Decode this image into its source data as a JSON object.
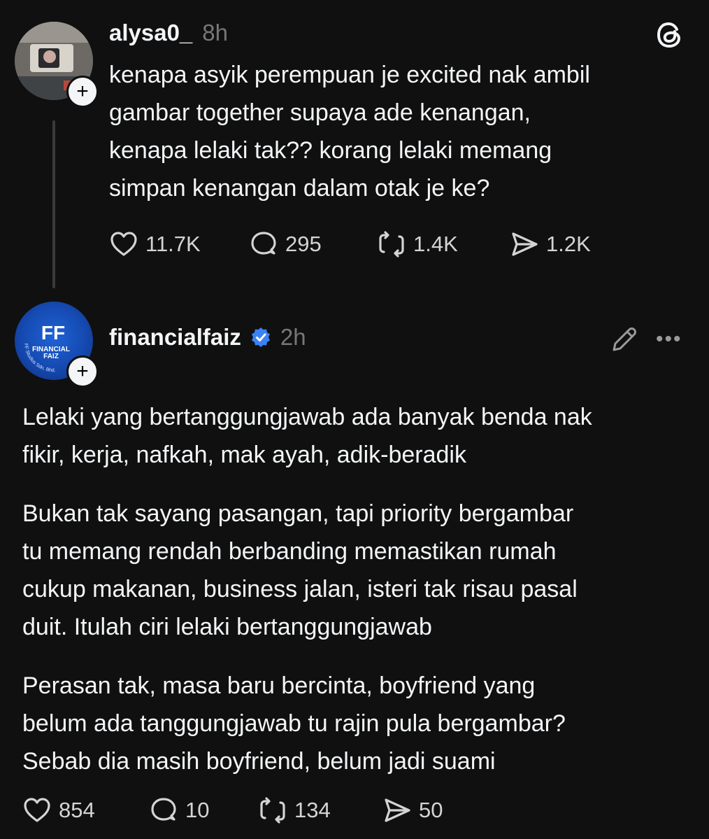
{
  "post1": {
    "username": "alysa0_",
    "timestamp": "8h",
    "text_lines": [
      "kenapa asyik perempuan je excited nak ambil",
      "gambar together supaya ade kenangan,",
      "kenapa lelaki tak?? korang lelaki memang",
      "simpan kenangan dalam otak je ke?"
    ],
    "actions": {
      "likes": "11.7K",
      "replies": "295",
      "reposts": "1.4K",
      "shares": "1.2K"
    }
  },
  "post2": {
    "username": "financialfaiz",
    "timestamp": "2h",
    "avatar_text": {
      "logo": "FF",
      "line1": "FINANCIAL",
      "line2": "FAIZ",
      "arc": "FF Studios Sdn. Bhd."
    },
    "paragraphs": [
      [
        "Lelaki yang bertanggungjawab ada banyak benda nak",
        "fikir, kerja, nafkah, mak ayah, adik-beradik"
      ],
      [
        "Bukan tak sayang pasangan, tapi priority bergambar",
        "tu memang rendah berbanding memastikan rumah",
        "cukup makanan, business jalan, isteri tak risau pasal",
        "duit. Itulah ciri lelaki bertanggungjawab"
      ],
      [
        "Perasan tak, masa baru bercinta, boyfriend yang",
        "belum ada tanggungjawab tu rajin pula bergambar?",
        "Sebab dia masih boyfriend, belum jadi suami"
      ]
    ],
    "actions": {
      "likes": "854",
      "replies": "10",
      "reposts": "134",
      "shares": "50"
    }
  },
  "icons": {
    "app_logo": "threads-logo-icon",
    "plus": "+",
    "more": "•••"
  },
  "colors": {
    "background": "#101010",
    "text": "#f3f5f7",
    "muted": "#777777",
    "verified": "#3b82f6"
  }
}
